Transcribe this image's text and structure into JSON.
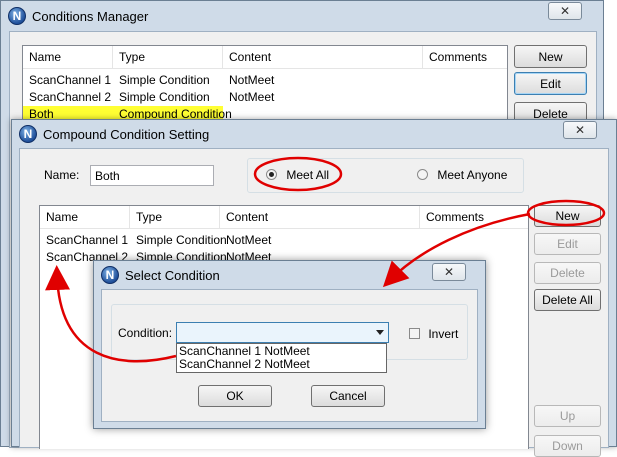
{
  "manager": {
    "icon_letter": "N",
    "title": "Conditions Manager",
    "columns": [
      "Name",
      "Type",
      "Content",
      "Comments"
    ],
    "rows": [
      {
        "name": "ScanChannel 1",
        "type": "Simple Condition",
        "content": "NotMeet",
        "comments": ""
      },
      {
        "name": "ScanChannel 2",
        "type": "Simple Condition",
        "content": "NotMeet",
        "comments": ""
      },
      {
        "name": "Both",
        "type": "Compound Condition",
        "content": "",
        "comments": ""
      }
    ],
    "buttons": {
      "new": "New",
      "edit": "Edit",
      "delete": "Delete"
    }
  },
  "compound": {
    "icon_letter": "N",
    "title": "Compound Condition Setting",
    "close_glyph": "✕",
    "name_label": "Name:",
    "name_value": "Both",
    "meet_all_label": "Meet All",
    "meet_anyone_label": "Meet Anyone",
    "columns": [
      "Name",
      "Type",
      "Content",
      "Comments"
    ],
    "rows": [
      {
        "name": "ScanChannel 1",
        "type": "Simple Condition",
        "content": "NotMeet",
        "comments": ""
      },
      {
        "name": "ScanChannel 2",
        "type": "Simple Condition",
        "content": "NotMeet",
        "comments": ""
      }
    ],
    "buttons": {
      "new": "New",
      "edit": "Edit",
      "delete": "Delete",
      "delete_all": "Delete All",
      "up": "Up",
      "down": "Down"
    }
  },
  "select": {
    "icon_letter": "N",
    "title": "Select Condition",
    "close_glyph": "✕",
    "condition_label": "Condition:",
    "condition_value": "",
    "options": [
      "ScanChannel 1 NotMeet",
      "ScanChannel 2 NotMeet"
    ],
    "invert_label": "Invert",
    "ok_label": "OK",
    "cancel_label": "Cancel"
  },
  "colors": {
    "highlight_row": "#ffff33",
    "annotation_red": "#e00000",
    "window_frame": "#c7d6e6"
  }
}
